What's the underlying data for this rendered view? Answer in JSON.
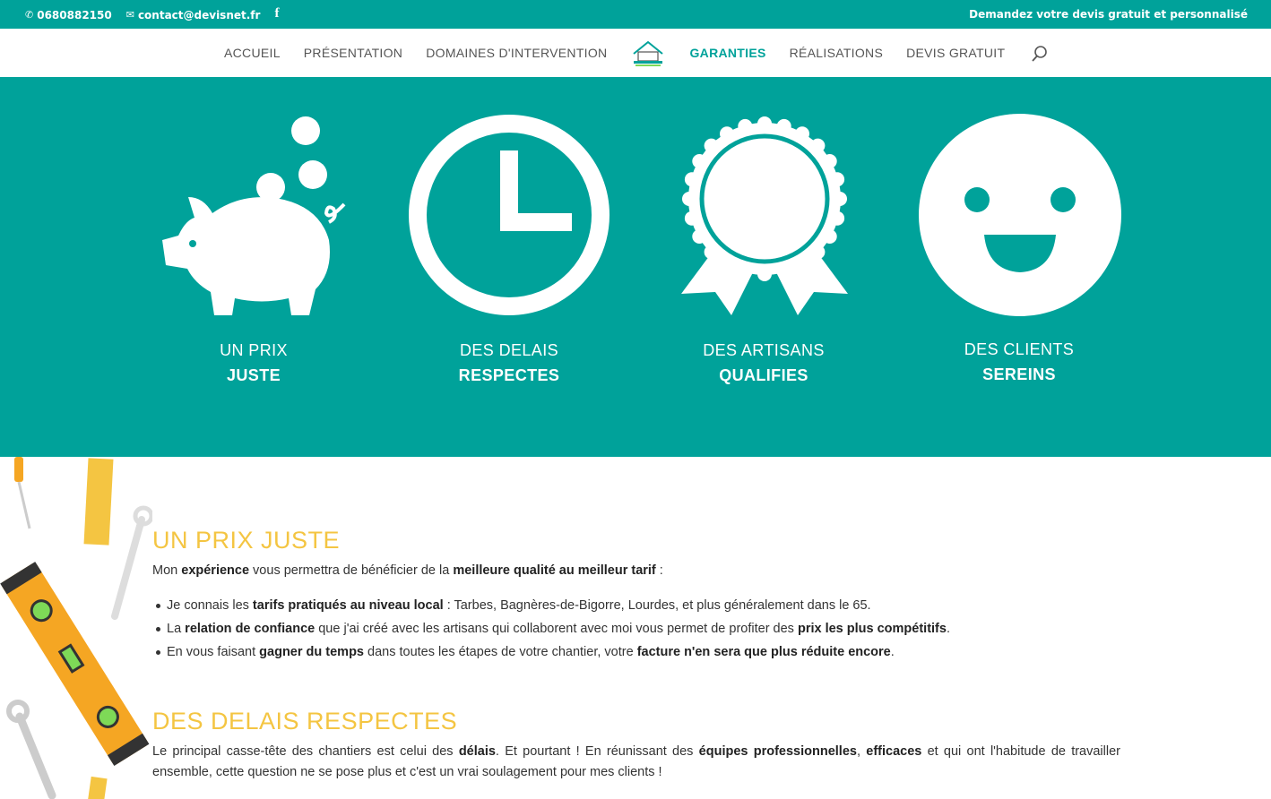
{
  "topbar": {
    "phone": "0680882150",
    "email": "contact@devisnet.fr",
    "social_icon": "facebook-icon",
    "cta": "Demandez votre devis gratuit et personnalisé"
  },
  "nav": {
    "items": [
      {
        "label": "ACCUEIL",
        "active": false
      },
      {
        "label": "PRÉSENTATION",
        "active": false
      },
      {
        "label": "DOMAINES D'INTERVENTION",
        "active": false
      },
      {
        "label": "GARANTIES",
        "active": true
      },
      {
        "label": "RÉALISATIONS",
        "active": false
      },
      {
        "label": "DEVIS GRATUIT",
        "active": false
      }
    ],
    "logo_icon": "house-logo-icon",
    "search_icon": "search-icon"
  },
  "hero": {
    "features": [
      {
        "icon": "piggy-bank-icon",
        "line1": "UN PRIX",
        "line2": "JUSTE"
      },
      {
        "icon": "clock-icon",
        "line1": "DES DELAIS",
        "line2": "RESPECTES"
      },
      {
        "icon": "award-rosette-icon",
        "line1": "DES ARTISANS",
        "line2": "QUALIFIES"
      },
      {
        "icon": "smiley-icon",
        "line1": "DES CLIENTS",
        "line2": "SEREINS"
      }
    ]
  },
  "section1": {
    "title": "UN PRIX JUSTE",
    "intro": [
      {
        "t": "Mon ",
        "b": false
      },
      {
        "t": "expérience",
        "b": true
      },
      {
        "t": " vous permettra de bénéficier de la ",
        "b": false
      },
      {
        "t": "meilleure qualité au meilleur tarif",
        "b": true
      },
      {
        "t": " :",
        "b": false
      }
    ],
    "bullets": [
      [
        {
          "t": "Je connais les ",
          "b": false
        },
        {
          "t": "tarifs pratiqués au niveau local",
          "b": true
        },
        {
          "t": " : Tarbes, Bagnères-de-Bigorre, Lourdes, et plus généralement dans le 65.",
          "b": false
        }
      ],
      [
        {
          "t": "La ",
          "b": false
        },
        {
          "t": "relation de confiance",
          "b": true
        },
        {
          "t": " que j'ai créé avec les artisans qui collaborent avec moi vous permet de profiter des ",
          "b": false
        },
        {
          "t": "prix les plus compétitifs",
          "b": true
        },
        {
          "t": ".",
          "b": false
        }
      ],
      [
        {
          "t": "En vous faisant ",
          "b": false
        },
        {
          "t": "gagner du temps",
          "b": true
        },
        {
          "t": " dans toutes les étapes de votre chantier, votre ",
          "b": false
        },
        {
          "t": "facture n'en sera que plus réduite encore",
          "b": true
        },
        {
          "t": ".",
          "b": false
        }
      ]
    ]
  },
  "section2": {
    "title": "DES DELAIS RESPECTES",
    "paragraph": [
      {
        "t": "Le principal casse-tête des chantiers est celui des ",
        "b": false
      },
      {
        "t": "délais",
        "b": true
      },
      {
        "t": ". Et pourtant ! En réunissant des ",
        "b": false
      },
      {
        "t": "équipes professionnelles",
        "b": true
      },
      {
        "t": ", ",
        "b": false
      },
      {
        "t": "efficaces",
        "b": true
      },
      {
        "t": " et qui ont l'habitude de travailler ensemble, cette question ne se pose plus et c'est un vrai soulagement pour mes clients !",
        "b": false
      }
    ]
  },
  "decor": {
    "tools_icon": "construction-tools-icon"
  }
}
